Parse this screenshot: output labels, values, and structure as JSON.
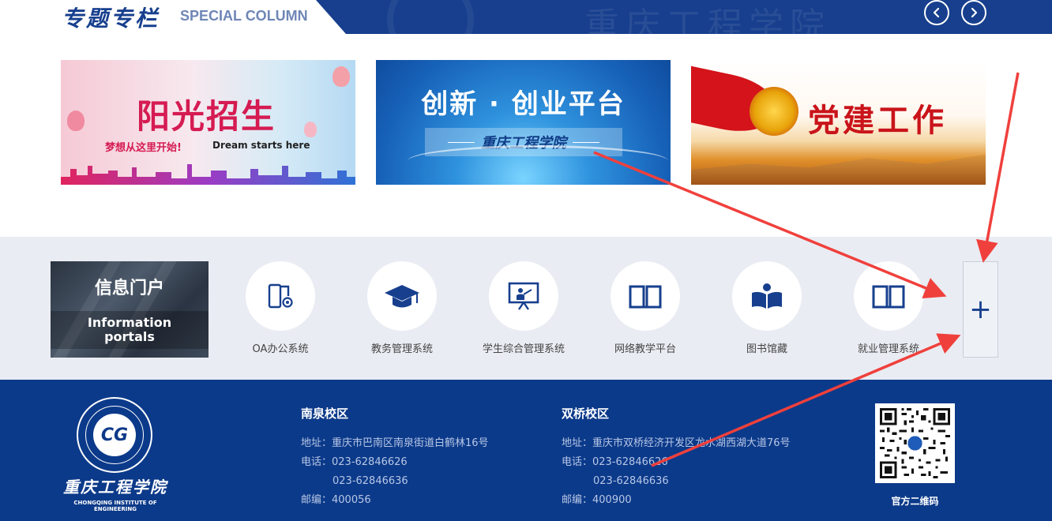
{
  "special_column": {
    "title_cn": "专题专栏",
    "title_en": "SPECIAL COLUMN",
    "watermark": "重庆工程学院",
    "prev_icon": "chevron-left-icon",
    "next_icon": "chevron-right-icon"
  },
  "banners": [
    {
      "title": "阳光招生",
      "subtitle": "梦想从这里开始!",
      "subtitle_en": "Dream starts here"
    },
    {
      "title": "创新 · 创业平台",
      "subtitle": "重庆工程学院"
    },
    {
      "title": "党建工作"
    }
  ],
  "portal": {
    "logo_cn": "信息门户",
    "logo_en_line1": "Information",
    "logo_en_line2": "portals",
    "systems": [
      {
        "label": "OA办公系统",
        "icon": "oa-document-icon"
      },
      {
        "label": "教务管理系统",
        "icon": "graduation-cap-icon"
      },
      {
        "label": "学生综合管理系统",
        "icon": "presentation-board-icon"
      },
      {
        "label": "网络教学平台",
        "icon": "open-book-icon"
      },
      {
        "label": "图书馆藏",
        "icon": "reader-book-icon"
      },
      {
        "label": "就业管理系统",
        "icon": "open-book-icon"
      }
    ],
    "more_label": "+"
  },
  "footer": {
    "school_cn": "重庆工程学院",
    "school_en": "CHONGQING INSTITUTE OF ENGINEERING",
    "campus_nanquan": {
      "name": "南泉校区",
      "address": "地址：重庆市巴南区南泉街道白鹤林16号",
      "phone1": "电话：023-62846626",
      "phone2": "023-62846636",
      "postcode": "邮编：400056"
    },
    "campus_shuangqiao": {
      "name": "双桥校区",
      "address": "地址：重庆市双桥经济开发区龙水湖西湖大道76号",
      "phone1": "电话：023-62846626",
      "phone2": "023-62846636",
      "postcode": "邮编：400900"
    },
    "qr_label": "官方二维码"
  },
  "colors": {
    "brand_blue": "#173f8e",
    "footer_blue": "#0c3a8a",
    "portal_bg": "#e9ecf2",
    "annotation_red": "#f0403c"
  }
}
